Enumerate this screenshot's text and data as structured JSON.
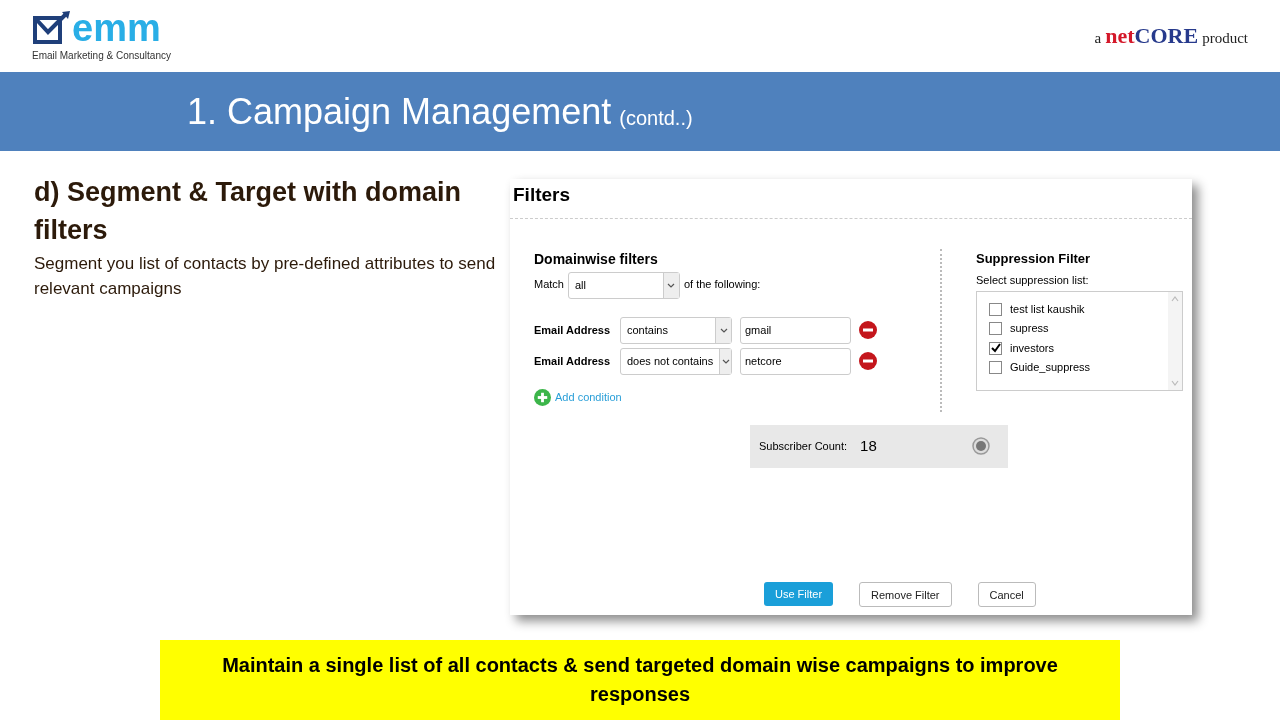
{
  "header": {
    "logo": {
      "wordmark": "emm",
      "tagline": "Email Marketing & Consultancy"
    },
    "partner": {
      "prefix": "a",
      "brand_first": "net",
      "brand_second": "CORE",
      "suffix": "product"
    }
  },
  "banner": {
    "title": "1. Campaign Management",
    "subtitle": "(contd..)"
  },
  "section": {
    "heading": "d) Segment & Target with domain filters",
    "description": "Segment you list of contacts by pre-defined  attributes to send relevant campaigns"
  },
  "dialog": {
    "title": "Filters",
    "domain_filters": {
      "heading": "Domainwise filters",
      "match_label": "Match",
      "match_value": "all",
      "match_suffix": "of the following:",
      "conditions": [
        {
          "field": "Email Address",
          "operator": "contains",
          "value": "gmail"
        },
        {
          "field": "Email Address",
          "operator": "does not contains",
          "value": "netcore"
        }
      ],
      "add_condition": "Add condition"
    },
    "suppression": {
      "heading": "Suppression Filter",
      "label": "Select suppression list:",
      "lists": [
        {
          "name": "test list kaushik",
          "checked": false
        },
        {
          "name": "supress",
          "checked": false
        },
        {
          "name": "investors",
          "checked": true
        },
        {
          "name": "Guide_suppress",
          "checked": false
        }
      ]
    },
    "subscriber_count": {
      "label": "Subscriber Count:",
      "value": "18"
    },
    "buttons": [
      {
        "label": "Use Filter",
        "kind": "primary"
      },
      {
        "label": "Remove Filter",
        "kind": "secondary"
      },
      {
        "label": "Cancel",
        "kind": "secondary"
      }
    ]
  },
  "footer_note": "Maintain a single list of all contacts & send targeted domain wise campaigns to improve responses"
}
